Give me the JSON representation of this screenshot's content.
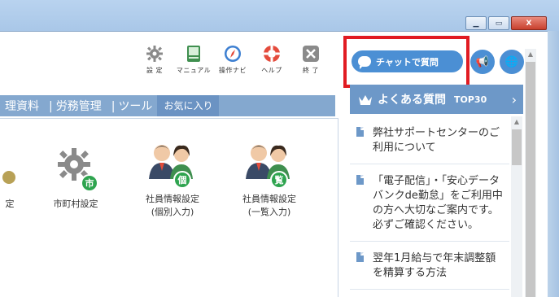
{
  "window": {
    "min_icon": "minimize-icon",
    "max_icon": "maximize-icon",
    "close_icon": "close-icon",
    "close_glyph": "X"
  },
  "toolbar": {
    "items": [
      {
        "label": "設 定",
        "icon": "gear-icon"
      },
      {
        "label": "マニュアル",
        "icon": "manual-book-icon"
      },
      {
        "label": "操作ナビ",
        "icon": "compass-icon"
      },
      {
        "label": "ヘルプ",
        "icon": "lifebuoy-icon"
      },
      {
        "label": "終 了",
        "icon": "close-icon"
      }
    ]
  },
  "chat": {
    "label": "チャットで質問"
  },
  "tabs": [
    "理資料",
    "労務管理",
    "ツール",
    "お気に入り"
  ],
  "items": [
    {
      "label": "定"
    },
    {
      "label": "市町村設定",
      "badge": "市"
    },
    {
      "label_line1": "社員情報設定",
      "label_line2": "(個別入力)",
      "badge": "個"
    },
    {
      "label_line1": "社員情報設定",
      "label_line2": "(一覧入力)",
      "badge": "覧"
    }
  ],
  "faq": {
    "title": "よくある質問",
    "top": "TOP30",
    "arrow": "›",
    "items": [
      "弊社サポートセンターのご利用について",
      "「電子配信」・「安心データバンクde勤怠」をご利用中の方へ大切なご案内です。必ずご確認ください。",
      "翌年1月給与で年末調整額を精算する方法"
    ]
  },
  "colors": {
    "accent": "#4b8fd4",
    "tab_bg": "#84a8cf",
    "highlight": "#e11b22",
    "green_badge": "#2ea44f"
  }
}
